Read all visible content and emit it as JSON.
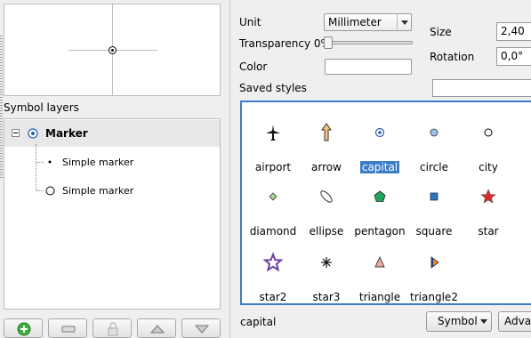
{
  "left": {
    "symbol_layers_label": "Symbol layers",
    "tree": [
      {
        "label": "Marker"
      },
      {
        "label": "Simple marker"
      },
      {
        "label": "Simple marker"
      }
    ]
  },
  "right": {
    "unit_label": "Unit",
    "unit_value": "Millimeter",
    "transparency_label": "Transparency 0%",
    "transparency_value": 0,
    "color_label": "Color",
    "size_label": "Size",
    "size_value": "2,40",
    "rotation_label": "Rotation",
    "rotation_value": "0,0°",
    "saved_styles_label": "Saved styles",
    "symbols": [
      {
        "name": "airport",
        "icon": "airport-icon"
      },
      {
        "name": "arrow",
        "icon": "arrow-icon"
      },
      {
        "name": "capital",
        "icon": "capital-icon",
        "selected": true
      },
      {
        "name": "circle",
        "icon": "circle-icon"
      },
      {
        "name": "city",
        "icon": "city-icon"
      },
      {
        "name": "diamond",
        "icon": "diamond-icon"
      },
      {
        "name": "ellipse",
        "icon": "ellipse-icon"
      },
      {
        "name": "pentagon",
        "icon": "pentagon-icon"
      },
      {
        "name": "square",
        "icon": "square-icon"
      },
      {
        "name": "star",
        "icon": "star-icon"
      },
      {
        "name": "star2",
        "icon": "star2-icon"
      },
      {
        "name": "star3",
        "icon": "star3-icon"
      },
      {
        "name": "triangle",
        "icon": "triangle-icon"
      },
      {
        "name": "triangle2",
        "icon": "triangle2-icon"
      }
    ],
    "status_text": "capital",
    "symbol_button": "Symbol",
    "advanced_button": "Advan"
  }
}
